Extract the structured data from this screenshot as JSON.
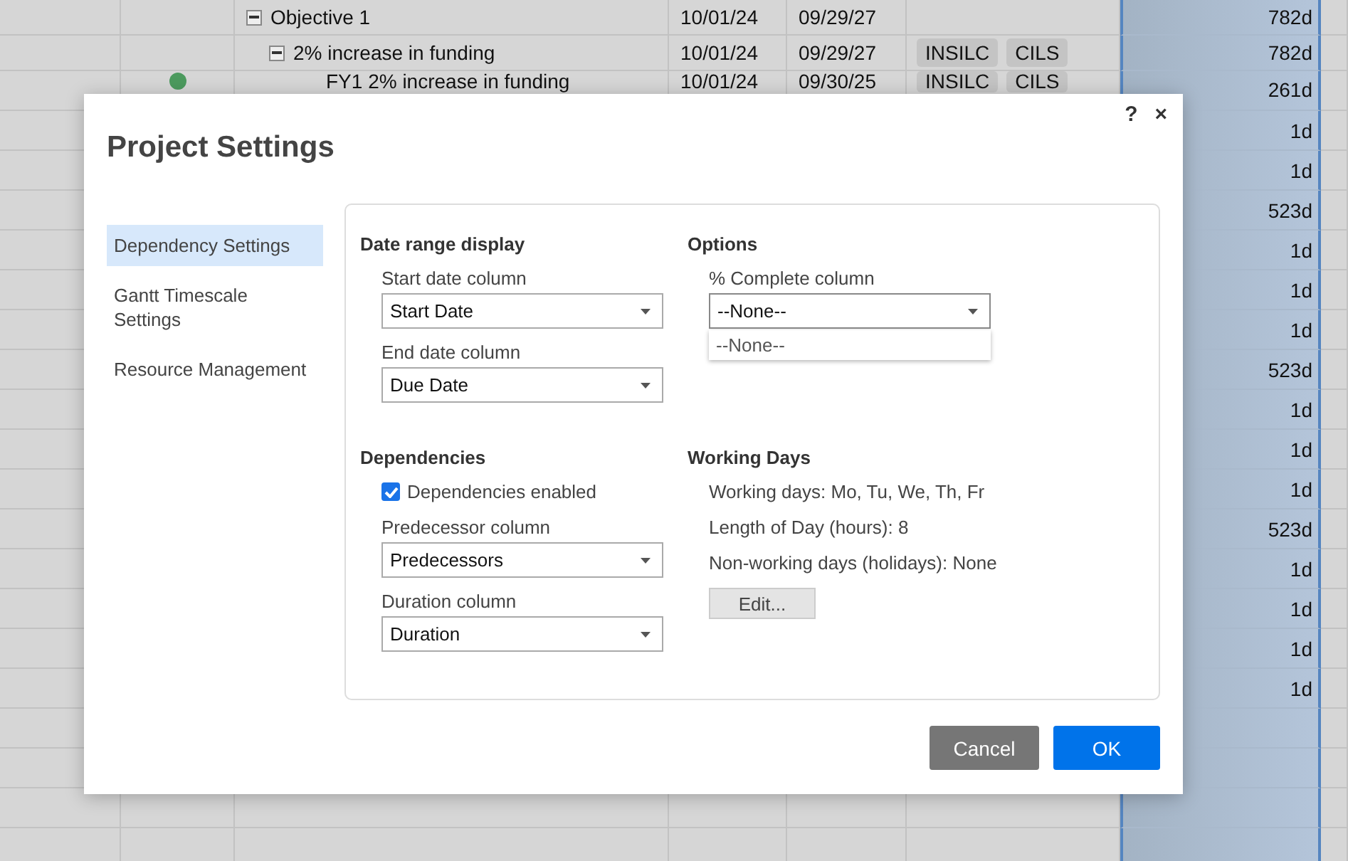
{
  "grid": {
    "tree_rows": [
      {
        "name": "Objective 1",
        "expanded": true,
        "start": "10/01/24",
        "end": "09/29/27",
        "duration": "782d",
        "children": [
          {
            "name": "2% increase in funding",
            "expanded": true,
            "start": "10/01/24",
            "end": "09/29/27",
            "tags": [
              "INSILC",
              "CILS"
            ],
            "duration": "782d",
            "children": [
              {
                "name": "FY1 2% increase in funding",
                "start": "10/01/24",
                "end": "09/30/25",
                "tags": [
                  "INSILC",
                  "CILS"
                ],
                "color": "#4c9a5e",
                "duration": "261d"
              }
            ]
          }
        ]
      }
    ],
    "more_rows": [
      {
        "duration": "1d"
      },
      {
        "duration": "1d"
      },
      {
        "duration": "523d"
      },
      {
        "duration": "1d"
      },
      {
        "duration": "1d"
      },
      {
        "duration": "1d"
      },
      {
        "duration": "523d"
      },
      {
        "duration": "1d"
      },
      {
        "duration": "1d"
      },
      {
        "duration": "1d"
      },
      {
        "duration": "523d"
      },
      {
        "duration": "1d"
      },
      {
        "duration": "1d"
      },
      {
        "duration": "1d"
      },
      {
        "duration": "1d"
      }
    ]
  },
  "dialog": {
    "title": "Project Settings",
    "help": "?",
    "close": "×",
    "nav": [
      {
        "label": "Dependency Settings",
        "selected": true
      },
      {
        "label": "Gantt Timescale Settings",
        "selected": false
      },
      {
        "label": "Resource Management",
        "selected": false
      }
    ],
    "date_range": {
      "heading": "Date range display",
      "fields": [
        {
          "label": "Start date column",
          "value": "Start Date"
        },
        {
          "label": "End date column",
          "value": "Due Date"
        }
      ]
    },
    "options": {
      "heading": "Options",
      "fields": [
        {
          "label": "% Complete column",
          "value": "--None--",
          "open": true,
          "options": [
            "--None--"
          ]
        }
      ]
    },
    "dependencies": {
      "heading": "Dependencies",
      "checkbox": {
        "label": "Dependencies enabled",
        "checked": true
      },
      "fields": [
        {
          "label": "Predecessor column",
          "value": "Predecessors"
        },
        {
          "label": "Duration column",
          "value": "Duration"
        }
      ]
    },
    "working_days": {
      "heading": "Working Days",
      "lines": [
        "Working days: Mo, Tu, We, Th, Fr",
        "Length of Day (hours): 8",
        "Non-working days (holidays): None"
      ],
      "edit_button": "Edit..."
    },
    "buttons": {
      "cancel": "Cancel",
      "ok": "OK"
    }
  }
}
